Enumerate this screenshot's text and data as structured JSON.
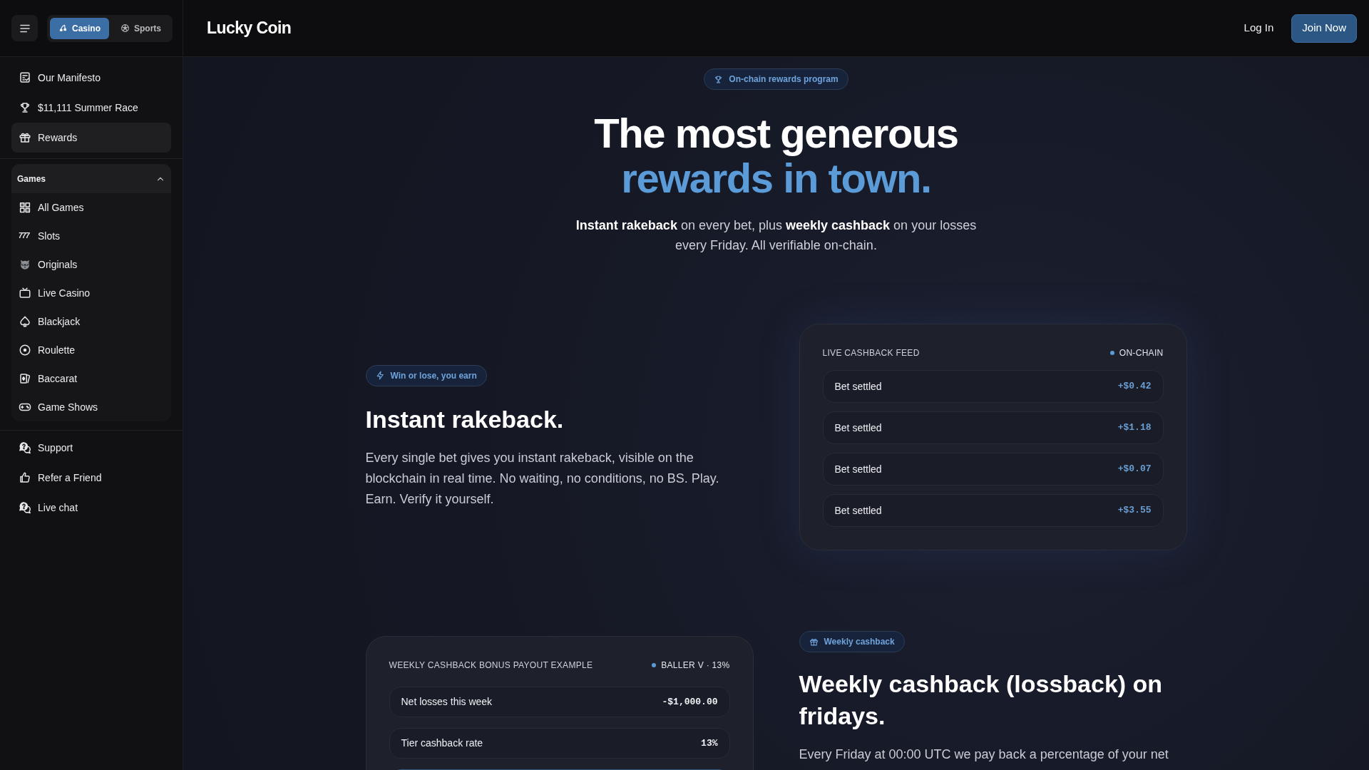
{
  "header": {
    "mode_tabs": [
      {
        "label": "Casino",
        "selected": true
      },
      {
        "label": "Sports",
        "selected": false
      }
    ],
    "logo": "Lucky Coin",
    "login": "Log In",
    "join": "Join Now"
  },
  "sidebar": {
    "top_items": [
      {
        "label": "Our Manifesto",
        "selected": false
      },
      {
        "label": "$11,111 Summer Race",
        "selected": false
      },
      {
        "label": "Rewards",
        "selected": true
      }
    ],
    "games": {
      "title": "Games",
      "expanded": true,
      "items": [
        {
          "label": "All Games",
          "selected": false
        },
        {
          "label": "Slots",
          "selected": false,
          "icon_text": "777"
        },
        {
          "label": "Originals",
          "selected": false
        },
        {
          "label": "Live Casino",
          "selected": false
        },
        {
          "label": "Blackjack",
          "selected": false
        },
        {
          "label": "Roulette",
          "selected": false
        },
        {
          "label": "Baccarat",
          "selected": false
        },
        {
          "label": "Game Shows",
          "selected": false
        }
      ]
    },
    "bottom_items": [
      {
        "label": "Support",
        "selected": false
      },
      {
        "label": "Refer a Friend",
        "selected": false
      },
      {
        "label": "Live chat",
        "selected": false
      }
    ]
  },
  "hero": {
    "tag": "On-chain rewards program",
    "title": "The most generous",
    "title_accent": "rewards in town.",
    "subtitle": "**Instant rakeback** on every bet, plus **weekly cashback** on your losses every Friday. All verifiable on-chain."
  },
  "rakeback": {
    "tag": "Win or lose, you earn",
    "title": "Instant rakeback.",
    "text": "Every single bet gives you instant rakeback, visible on the blockchain in real time. No waiting, no conditions, no BS. Play. Earn. Verify it yourself.",
    "feed": {
      "title": "LIVE CASHBACK FEED",
      "status": "ON-CHAIN",
      "rows": [
        {
          "label": "Bet settled",
          "amount": "+$0.42"
        },
        {
          "label": "Bet settled",
          "amount": "+$1.18"
        },
        {
          "label": "Bet settled",
          "amount": "+$0.07"
        },
        {
          "label": "Bet settled",
          "amount": "+$3.55"
        }
      ]
    }
  },
  "cashback": {
    "example": {
      "title": "WEEKLY CASHBACK BONUS PAYOUT EXAMPLE",
      "tier": "BALLER V · 13%",
      "rows": [
        {
          "label": "Net losses this week",
          "value": "-$1,000.00"
        },
        {
          "label": "Tier cashback rate",
          "value": "13%"
        }
      ]
    },
    "tag": "Weekly cashback",
    "title": "Weekly cashback (lossback) on fridays.",
    "text": "Every Friday at 00:00 UTC we pay back a percentage of your net"
  }
}
